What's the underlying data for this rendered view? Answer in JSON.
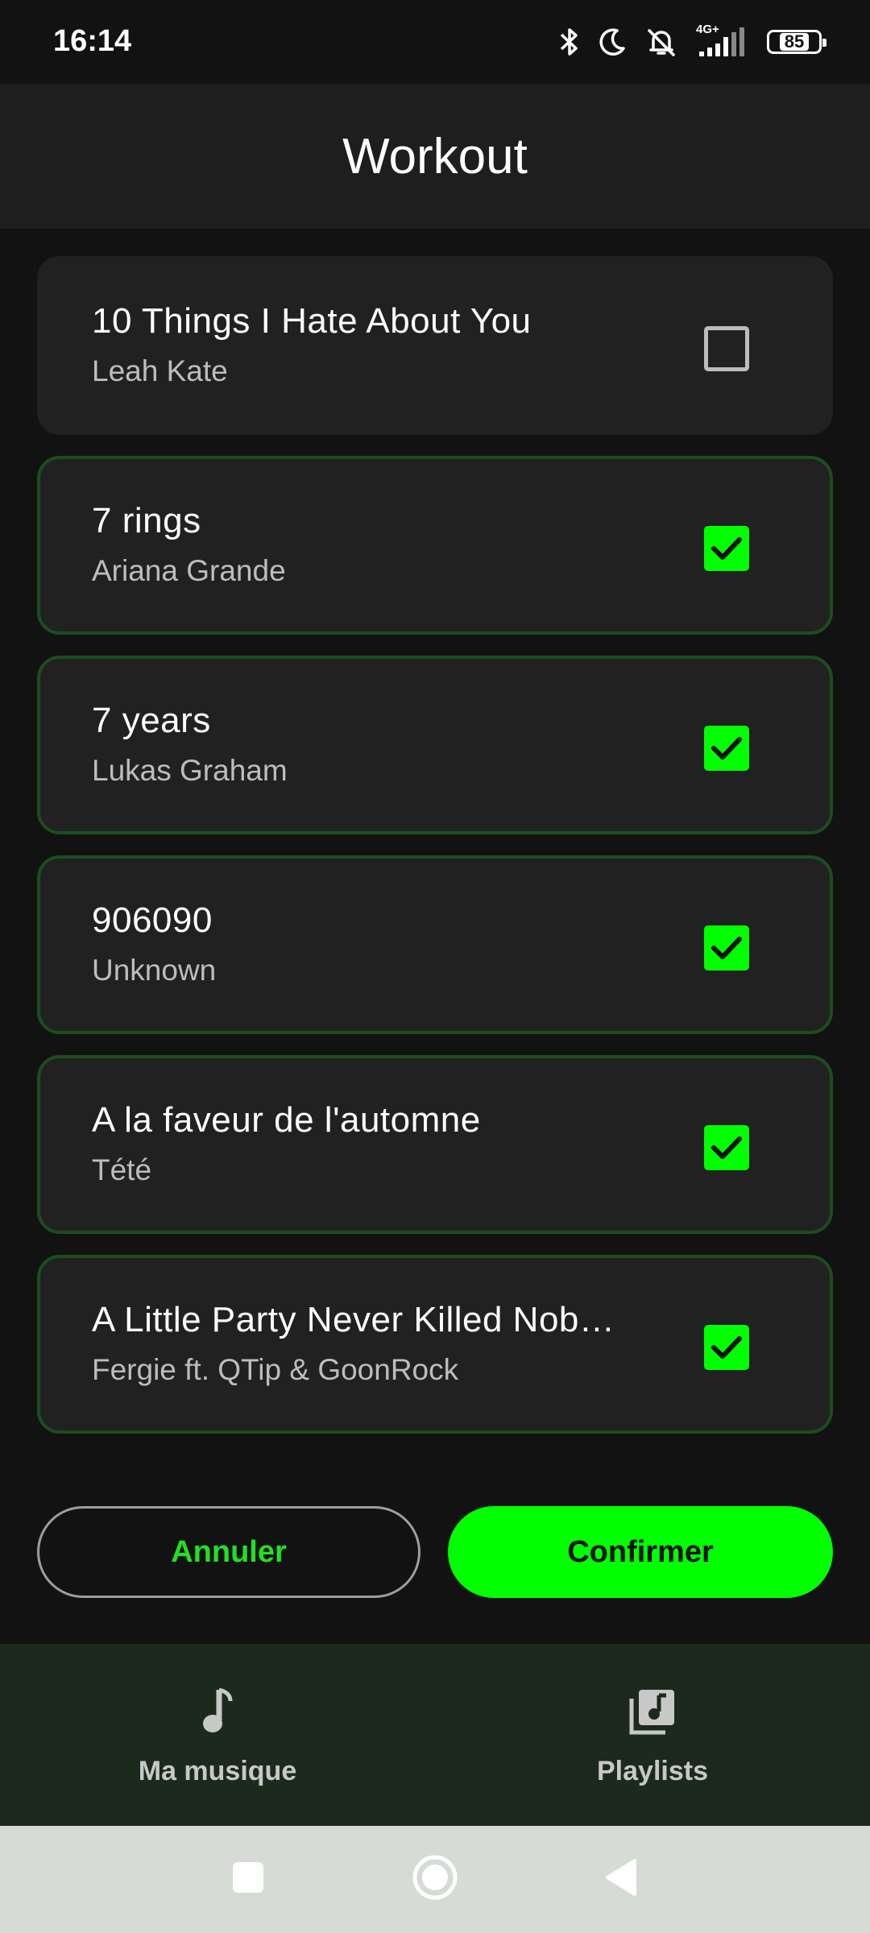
{
  "status_bar": {
    "time": "16:14",
    "network": "4G+",
    "battery": "85",
    "icons": [
      "bluetooth-icon",
      "moon-icon",
      "muted-bell-icon",
      "signal-icon",
      "battery-icon"
    ]
  },
  "header": {
    "title": "Workout"
  },
  "songs": [
    {
      "title": "10 Things I Hate About You",
      "artist": "Leah Kate",
      "checked": false
    },
    {
      "title": "7 rings",
      "artist": "Ariana Grande",
      "checked": true
    },
    {
      "title": "7 years",
      "artist": "Lukas Graham",
      "checked": true
    },
    {
      "title": "906090",
      "artist": "Unknown",
      "checked": true
    },
    {
      "title": "A la faveur de l'automne",
      "artist": "Tété",
      "checked": true
    },
    {
      "title": "A Little Party Never Killed Nob…",
      "artist": "Fergie ft. QTip & GoonRock",
      "checked": true
    }
  ],
  "actions": {
    "cancel_label": "Annuler",
    "confirm_label": "Confirmer"
  },
  "bottom_nav": [
    {
      "label": "Ma musique",
      "icon": "music-note-icon"
    },
    {
      "label": "Playlists",
      "icon": "playlist-icon"
    }
  ],
  "system_nav": [
    "recents-button",
    "home-button",
    "back-button"
  ],
  "colors": {
    "accent": "#00ff00",
    "background": "#121212",
    "card": "#212121",
    "header": "#1e1e1e",
    "nav": "#1b2a1d",
    "selected_border": "#1c4d1e"
  }
}
